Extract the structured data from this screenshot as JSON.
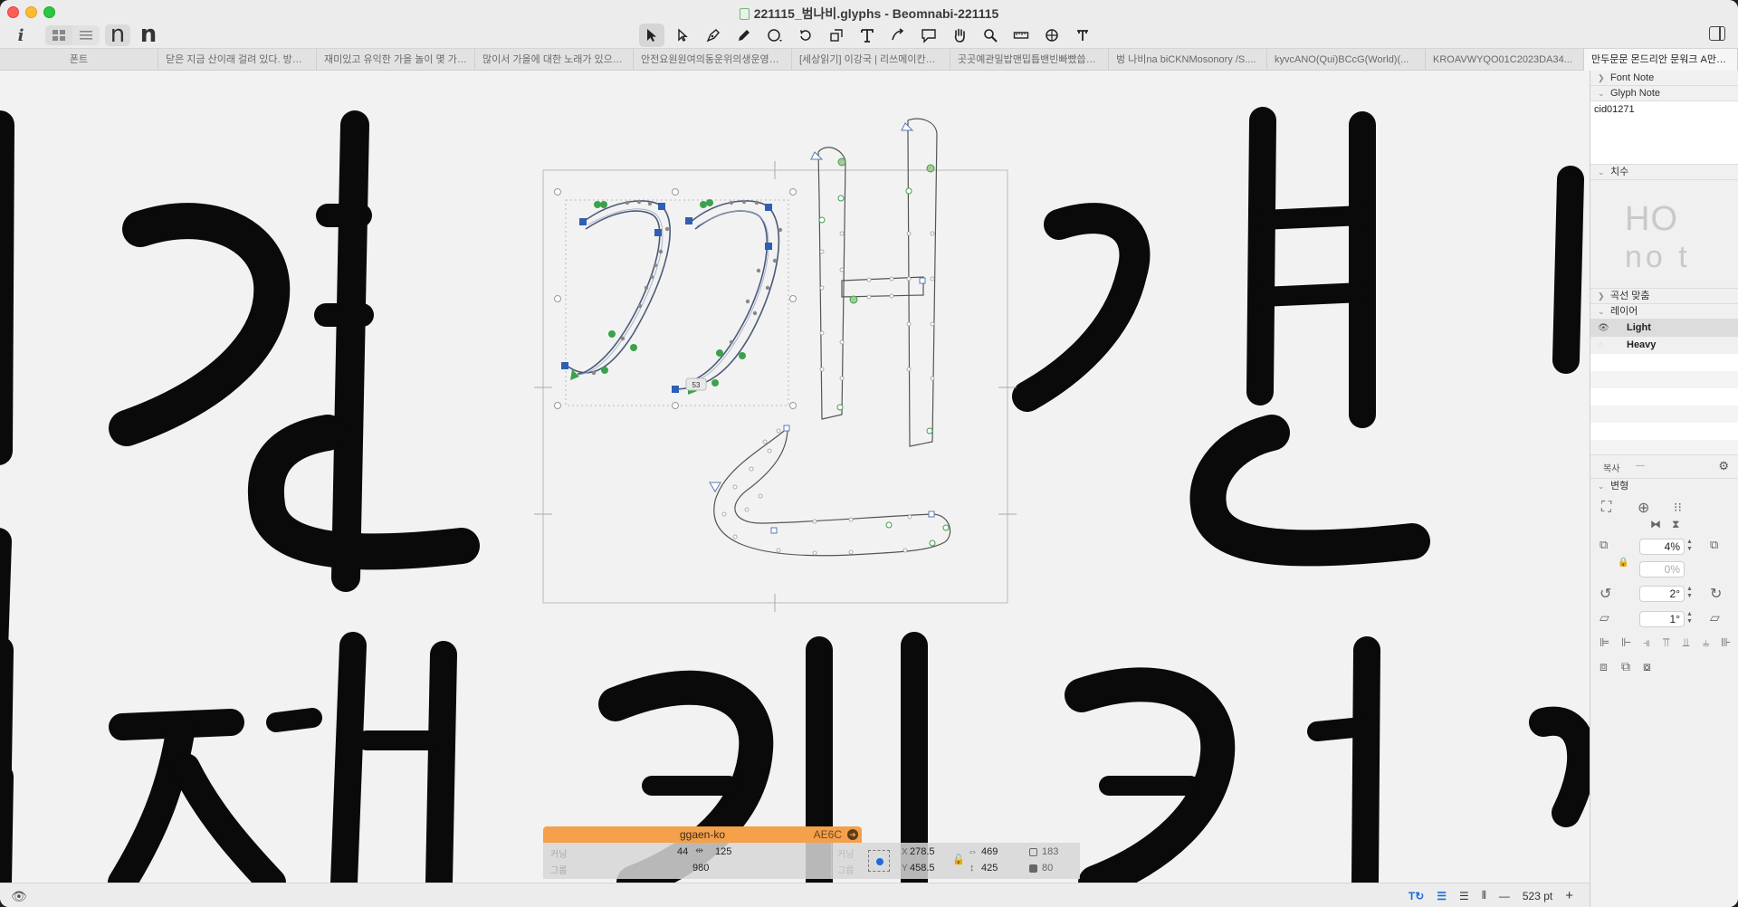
{
  "window": {
    "title": "221115_범나비.glyphs - Beomnabi-221115"
  },
  "toolbar": {
    "info_label": "i",
    "preview_chars": [
      "n",
      "n"
    ],
    "tools": [
      "select-tool",
      "select-all-layers-tool",
      "pen-tool",
      "pencil-tool",
      "draw-tool",
      "primitives-tool",
      "rotate-tool",
      "scale-tool",
      "text-tool",
      "annotation-tool",
      "bubble-tool",
      "hand-tool",
      "zoom-tool",
      "measure-tool",
      "knife-tool",
      "type-tool"
    ]
  },
  "tabs": [
    "폰트",
    "닫은 지금 산이래 걸려 있다. 방중을...",
    "재미있고 유익한 가을 놀이 몇 가지답...",
    "많이서 가을에 대한 노래가 있으면 그...",
    "안전요원원여의동운위의생운영안위을...",
    "[세상읽기] 이강국 | 리쓰메이칸대 경...",
    "곳곳예관밀밥맨밉틉밴빈빠빴씁씁...",
    "벙 나비na biCKNMosonory /S....",
    "kyvcANO(Qui)BCcG(World)(...",
    "KROAVWYQO01C2023DA34...",
    "만두문문 몬드리안 문워크 A만두/m..."
  ],
  "canvas": {
    "bg_glyphs_top": [
      "갠",
      "깬",
      "ㅂ"
    ],
    "bg_glyphs_bottom": [
      "짜",
      "캐",
      "케"
    ],
    "selection_label": "53"
  },
  "glyph_info": {
    "name": "ggaen-ko",
    "unicode": "AE6C",
    "kerning_label": "커닝",
    "group_label": "그룹",
    "lsb": "44",
    "rsb": "125",
    "width": "980",
    "x": "278.5",
    "y": "458.5",
    "w": "469",
    "h": "425",
    "sel_nodes": "183",
    "total_nodes": "80"
  },
  "status": {
    "zoom": "523 pt",
    "minus": "—",
    "plus": "+"
  },
  "inspector": {
    "font_note": "Font Note",
    "glyph_note": "Glyph Note",
    "glyph_note_text": "cid01271",
    "metrics_label": "치수",
    "metric_preview_top": "HO",
    "metric_preview_bottom": "no t",
    "curve_fit": "곡선 맞춤",
    "layers_label": "레이어",
    "layers": [
      "Light",
      "Heavy"
    ],
    "copy_label": "복사",
    "transform_label": "변형",
    "scale_value": "4%",
    "scale_value_2": "0%",
    "rotate_value": "2°",
    "slant_value": "1°"
  },
  "colors": {
    "accent": "#1f6bd6",
    "glyph_name_bar": "#f5a04a",
    "node_green": "#3aa34a",
    "node_blue": "#2e5fb4"
  }
}
